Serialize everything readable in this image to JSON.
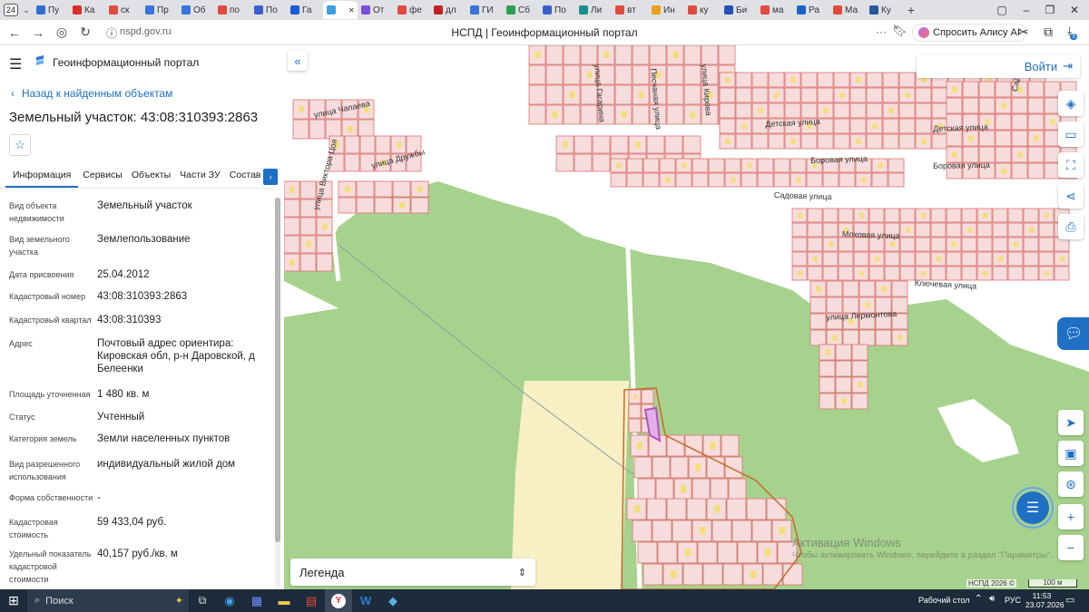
{
  "browser": {
    "tab_count": "24",
    "tabs": [
      {
        "label": "Пу",
        "color": "#2f6fd1"
      },
      {
        "label": "Ка",
        "color": "#d93025"
      },
      {
        "label": "ск",
        "color": "#e04a3f"
      },
      {
        "label": "Пр",
        "color": "#3a73d9"
      },
      {
        "label": "Об",
        "color": "#3a73d9"
      },
      {
        "label": "по",
        "color": "#e04a3f"
      },
      {
        "label": "По",
        "color": "#3a5fcd"
      },
      {
        "label": "Га",
        "color": "#1a5bd6"
      },
      {
        "label": "",
        "color": "#3ba0e0"
      },
      {
        "label": "От",
        "color": "#7b4fd6"
      },
      {
        "label": "фе",
        "color": "#e04a3f"
      },
      {
        "label": "дл",
        "color": "#c5221f"
      },
      {
        "label": "ГИ",
        "color": "#3a73d9"
      },
      {
        "label": "Сб",
        "color": "#2e9e50"
      },
      {
        "label": "По",
        "color": "#3a5fcd"
      },
      {
        "label": "Ли",
        "color": "#1b8f8f"
      },
      {
        "label": "вт",
        "color": "#e04a3f"
      },
      {
        "label": "Ин",
        "color": "#e8a317"
      },
      {
        "label": "ку",
        "color": "#e04a3f"
      },
      {
        "label": "Би",
        "color": "#2451b7"
      },
      {
        "label": "ма",
        "color": "#e04a3f"
      },
      {
        "label": "Ра",
        "color": "#1a64c8"
      },
      {
        "label": "Ма",
        "color": "#e04a3f"
      },
      {
        "label": "Ку",
        "color": "#26579b"
      }
    ],
    "url": "nspd.gov.ru",
    "page_title": "НСПД | Геоинформационный портал",
    "alisa_label": "Спросить Алису AI",
    "ext_badge": "5"
  },
  "app": {
    "title": "Геоинформационный портал",
    "back_label": "Назад к найденным объектам",
    "heading": "Земельный участок: 43:08:310393:2863",
    "tabs": [
      "Информация",
      "Сервисы",
      "Объекты",
      "Части ЗУ",
      "Состав"
    ],
    "fields": [
      {
        "key": "Вид объекта недвижимости",
        "value": "Земельный участок"
      },
      {
        "key": "Вид земельного участка",
        "value": "Землепользование"
      },
      {
        "key": "Дата присвоения",
        "value": "25.04.2012"
      },
      {
        "key": "Кадастровый номер",
        "value": "43:08:310393:2863"
      },
      {
        "key": "Кадастровый квартал",
        "value": "43:08:310393"
      },
      {
        "key": "Адрес",
        "value": "Почтовый адрес ориентира: Кировская обл, р-н Даровской, д Белеенки"
      },
      {
        "key": "Площадь уточненная",
        "value": "1 480 кв. м"
      },
      {
        "key": "Статус",
        "value": "Учтенный"
      },
      {
        "key": "Категория земель",
        "value": "Земли населенных пунктов"
      },
      {
        "key": "Вид разрешенного использования",
        "value": "индивидуальный жилой дом"
      },
      {
        "key": "Форма собственности",
        "value": "-"
      },
      {
        "key": "Кадастровая стоимость",
        "value": "59 433,04 руб."
      },
      {
        "key": "Удельный показатель кадастровой стоимости",
        "value": "40,157 руб./кв. м"
      }
    ]
  },
  "map": {
    "login_label": "Войти",
    "legend_label": "Легенда",
    "attribution": "НСПД 2026 ©",
    "scale_label": "100 м",
    "watermark_title": "Активация Windows",
    "watermark_text": "Чтобы активировать Windows, перейдите в раздел \"Параметры\".",
    "streets": [
      "улица Чапаева",
      "улица Дружбы",
      "улица Виктора Цоя",
      "Детская улица",
      "Боровая улица",
      "Садовая улица",
      "Моховая улица",
      "Ключевая улица",
      "улица Лермонтова",
      "Детская улица",
      "Боровая улица",
      "улица Гагарина",
      "Песчаная улица",
      "улица Кирова",
      "Садовая"
    ]
  },
  "taskbar": {
    "search_label": "Поиск",
    "desktop_label": "Рабочий стол",
    "lang": "РУС",
    "time": "11:53",
    "date": "23.07.2026"
  },
  "colors": {
    "accent": "#1f6fc5",
    "parcel_fill": "#f6dcdc",
    "parcel_stroke": "#d9736f",
    "forest": "#a7d28d",
    "field": "#f7f0c4",
    "selected": "#b84fc4"
  }
}
